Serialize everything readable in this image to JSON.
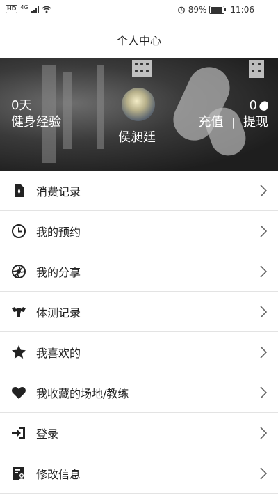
{
  "status_bar": {
    "hd": "HD",
    "network": "4G",
    "battery_percent_text": "89%",
    "battery_level": 0.89,
    "time": "11:06"
  },
  "header": {
    "title": "个人中心"
  },
  "profile": {
    "days_value": "0天",
    "days_label": "健身经验",
    "username": "侯昶廷",
    "balance_value": "0",
    "recharge_label": "充值",
    "separator": "|",
    "withdraw_label": "提现"
  },
  "menu": {
    "items": [
      {
        "label": "消费记录",
        "icon": "receipt-icon"
      },
      {
        "label": "我的预约",
        "icon": "clock-icon"
      },
      {
        "label": "我的分享",
        "icon": "aperture-icon"
      },
      {
        "label": "体测记录",
        "icon": "muscle-icon"
      },
      {
        "label": "我喜欢的",
        "icon": "star-icon"
      },
      {
        "label": "我收藏的场地/教练",
        "icon": "heart-icon"
      },
      {
        "label": "登录",
        "icon": "login-icon"
      },
      {
        "label": "修改信息",
        "icon": "edit-profile-icon"
      }
    ]
  }
}
